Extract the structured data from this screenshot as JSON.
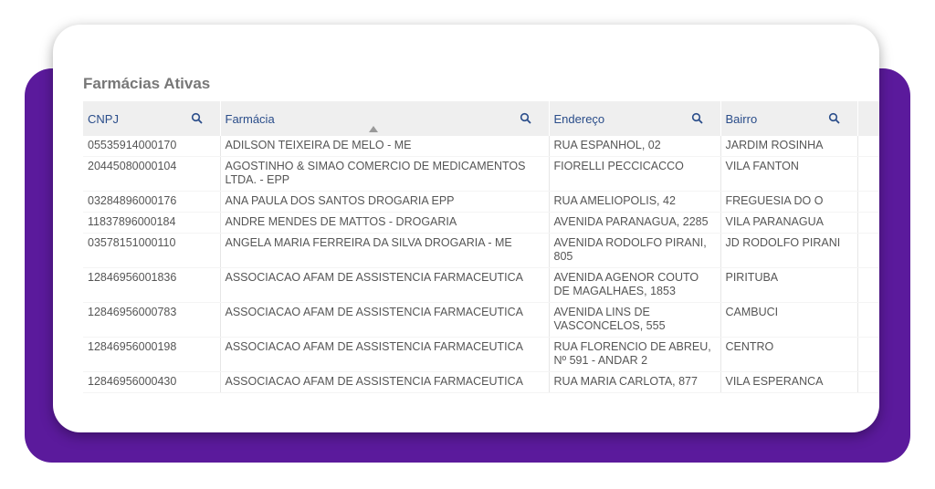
{
  "panel": {
    "title": "Farmácias Ativas"
  },
  "table": {
    "columns": [
      {
        "label": "CNPJ"
      },
      {
        "label": "Farmácia"
      },
      {
        "label": "Endereço"
      },
      {
        "label": "Bairro"
      }
    ],
    "rows": [
      [
        "05535914000170",
        "ADILSON TEIXEIRA DE MELO - ME",
        "RUA ESPANHOL, 02",
        "JARDIM ROSINHA"
      ],
      [
        "20445080000104",
        "AGOSTINHO & SIMAO COMERCIO DE MEDICAMENTOS LTDA. - EPP",
        "FIORELLI PECCICACCO",
        "VILA FANTON"
      ],
      [
        "03284896000176",
        "ANA PAULA DOS SANTOS DROGARIA EPP",
        "RUA AMELIOPOLIS, 42",
        "FREGUESIA DO O"
      ],
      [
        "11837896000184",
        "ANDRE MENDES DE MATTOS - DROGARIA",
        "AVENIDA PARANAGUA, 2285",
        "VILA PARANAGUA"
      ],
      [
        "03578151000110",
        "ANGELA MARIA FERREIRA DA SILVA DROGARIA - ME",
        "AVENIDA RODOLFO PIRANI, 805",
        "JD RODOLFO PIRANI"
      ],
      [
        "12846956001836",
        "ASSOCIACAO AFAM DE ASSISTENCIA FARMACEUTICA",
        "AVENIDA AGENOR COUTO DE MAGALHAES, 1853",
        "PIRITUBA"
      ],
      [
        "12846956000783",
        "ASSOCIACAO AFAM DE ASSISTENCIA FARMACEUTICA",
        "AVENIDA LINS DE VASCONCELOS, 555",
        "CAMBUCI"
      ],
      [
        "12846956000198",
        "ASSOCIACAO AFAM DE ASSISTENCIA FARMACEUTICA",
        "RUA FLORENCIO DE ABREU, Nº 591 - ANDAR 2",
        "CENTRO"
      ],
      [
        "12846956000430",
        "ASSOCIACAO AFAM DE ASSISTENCIA FARMACEUTICA",
        "RUA MARIA CARLOTA, 877",
        "VILA ESPERANCA"
      ]
    ]
  },
  "icons": {
    "search": "search-icon",
    "sort": "sort-ascending-icon"
  },
  "colors": {
    "accent_purple": "#5b1a9c",
    "header_text": "#2a4d8a",
    "header_bg": "#efefef",
    "cell_text": "#555555"
  }
}
